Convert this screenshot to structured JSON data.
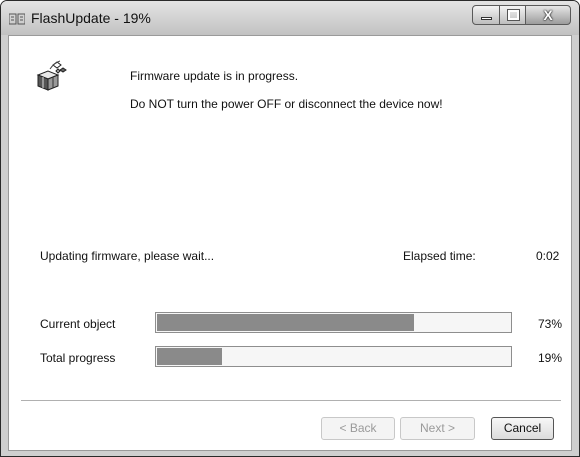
{
  "window": {
    "title": "FlashUpdate - 19%",
    "controls": [
      "minimize-icon",
      "maximize-icon",
      "close-icon"
    ],
    "close_glyph": "X"
  },
  "message": {
    "icon": "wizard-install-icon",
    "line1": "Firmware update is in progress.",
    "line2": "Do NOT turn the power OFF or disconnect the device now!"
  },
  "status": {
    "text": "Updating firmware, please wait...",
    "elapsed_label": "Elapsed time:",
    "elapsed_value": "0:02"
  },
  "progress": [
    {
      "label": "Current object",
      "percent": 73,
      "percent_text": "73%"
    },
    {
      "label": "Total progress",
      "percent": 19,
      "percent_text": "19%"
    }
  ],
  "buttons": {
    "back": "< Back",
    "next": "Next >",
    "cancel": "Cancel"
  },
  "colors": {
    "progress_fill": "#8a8a8a",
    "disabled_text": "#9a9a9a"
  }
}
